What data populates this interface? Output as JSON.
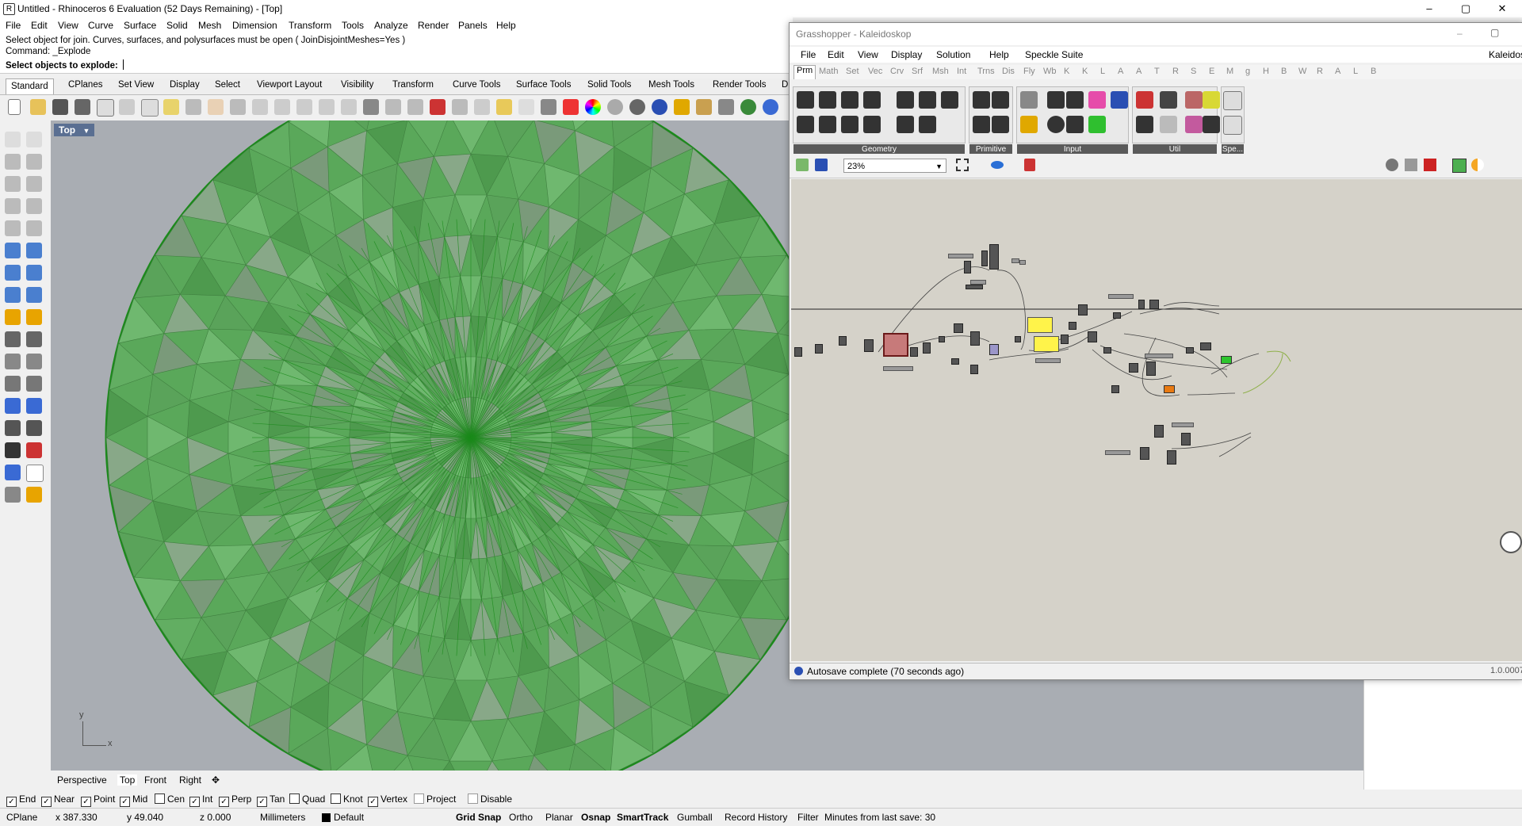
{
  "rhino": {
    "title": "Untitled - Rhinoceros 6 Evaluation (52 Days Remaining) - [Top]",
    "window_buttons": [
      "–",
      "▢",
      "✕"
    ],
    "menu": [
      "File",
      "Edit",
      "View",
      "Curve",
      "Surface",
      "Solid",
      "Mesh",
      "Dimension",
      "Transform",
      "Tools",
      "Analyze",
      "Render",
      "Panels",
      "Help"
    ],
    "command": {
      "line1": "Select object for join.  Curves, surfaces, and polysurfaces must be open ( JoinDisjointMeshes=Yes )",
      "line2": "Command: _Explode",
      "prompt": "Select objects to explode:"
    },
    "toolbar_tabs": [
      "Standard",
      "CPlanes",
      "Set View",
      "Display",
      "Select",
      "Viewport Layout",
      "Visibility",
      "Transform",
      "Curve Tools",
      "Surface Tools",
      "Solid Tools",
      "Mesh Tools",
      "Render Tools",
      "D"
    ],
    "viewport": {
      "label": "Top",
      "axis_y": "y",
      "axis_x": "x",
      "mesh_color": "#5aa85a",
      "edge_color": "#1b8a1b"
    },
    "viewport_tabs": [
      "Perspective",
      "Top",
      "Front",
      "Right",
      "✥"
    ],
    "osnaps": [
      {
        "label": "End",
        "checked": true
      },
      {
        "label": "Near",
        "checked": true
      },
      {
        "label": "Point",
        "checked": true
      },
      {
        "label": "Mid",
        "checked": true
      },
      {
        "label": "Cen",
        "checked": false
      },
      {
        "label": "Int",
        "checked": true
      },
      {
        "label": "Perp",
        "checked": true
      },
      {
        "label": "Tan",
        "checked": true
      },
      {
        "label": "Quad",
        "checked": false
      },
      {
        "label": "Knot",
        "checked": false
      },
      {
        "label": "Vertex",
        "checked": true
      },
      {
        "label": "Project",
        "checked": false
      },
      {
        "label": "Disable",
        "checked": false
      }
    ],
    "status": {
      "cplane": "CPlane",
      "x": "x 387.330",
      "y": "y 49.040",
      "z": "z 0.000",
      "units": "Millimeters",
      "layer": "Default",
      "grid_snap": "Grid Snap",
      "ortho": "Ortho",
      "planar": "Planar",
      "osnap": "Osnap",
      "smarttrack": "SmartTrack",
      "gumball": "Gumball",
      "record_history": "Record History",
      "filter": "Filter",
      "save_info": "Minutes from last save: 30"
    }
  },
  "grasshopper": {
    "title": "Grasshopper - Kaleidoskop",
    "menu": [
      "File",
      "Edit",
      "View",
      "Display",
      "Solution",
      "Help",
      "Speckle Suite"
    ],
    "doc_name": "Kaleidos",
    "component_tabs": [
      "Prm",
      "Math",
      "Set",
      "Vec",
      "Crv",
      "Srf",
      "Msh",
      "Int",
      "Trns",
      "Dis",
      "Fly",
      "Wb",
      "K",
      "K",
      "L",
      "A",
      "A",
      "T",
      "R",
      "S",
      "E",
      "M",
      "g",
      "H",
      "B",
      "W",
      "R",
      "A",
      "L",
      "B"
    ],
    "panels": [
      "Geometry",
      "Primitive",
      "Input",
      "Util",
      "Spe..."
    ],
    "zoom": "23%",
    "status": "Autosave complete (70 seconds ago)",
    "version": "1.0.0007"
  }
}
